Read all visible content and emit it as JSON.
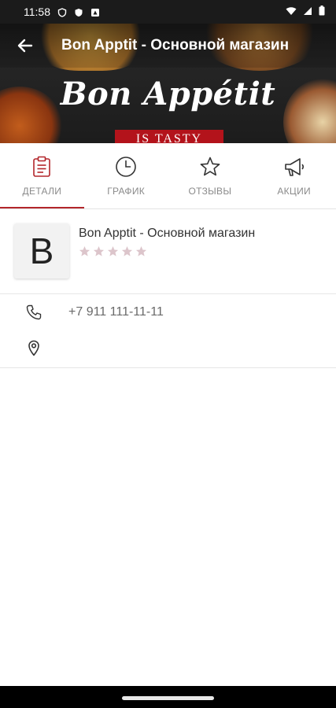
{
  "status_bar": {
    "time": "11:58",
    "icons": [
      "shield-icon",
      "shield-icon",
      "notification-icon",
      "wifi-icon",
      "signal-icon",
      "battery-icon"
    ]
  },
  "toolbar": {
    "title": "Bon Apptit - Основной магазин",
    "back_icon": "arrow-left-icon"
  },
  "banner": {
    "brand": "Bon Appétit",
    "tagline": "IS TASTY"
  },
  "tabs": [
    {
      "label": "ДЕТАЛИ",
      "icon": "clipboard-icon",
      "active": true
    },
    {
      "label": "ГРАФИК",
      "icon": "clock-icon",
      "active": false
    },
    {
      "label": "ОТЗЫВЫ",
      "icon": "star-outline-icon",
      "active": false
    },
    {
      "label": "АКЦИИ",
      "icon": "megaphone-icon",
      "active": false
    }
  ],
  "store": {
    "avatar_letter": "B",
    "name": "Bon Apptit - Основной магазин",
    "rating": 0,
    "rating_max": 5
  },
  "contacts": {
    "phone": "+7 911 111-11-11",
    "address": ""
  },
  "colors": {
    "accent": "#b3262b",
    "star": "#dcc5cb",
    "muted_text": "#8a8a8a"
  }
}
